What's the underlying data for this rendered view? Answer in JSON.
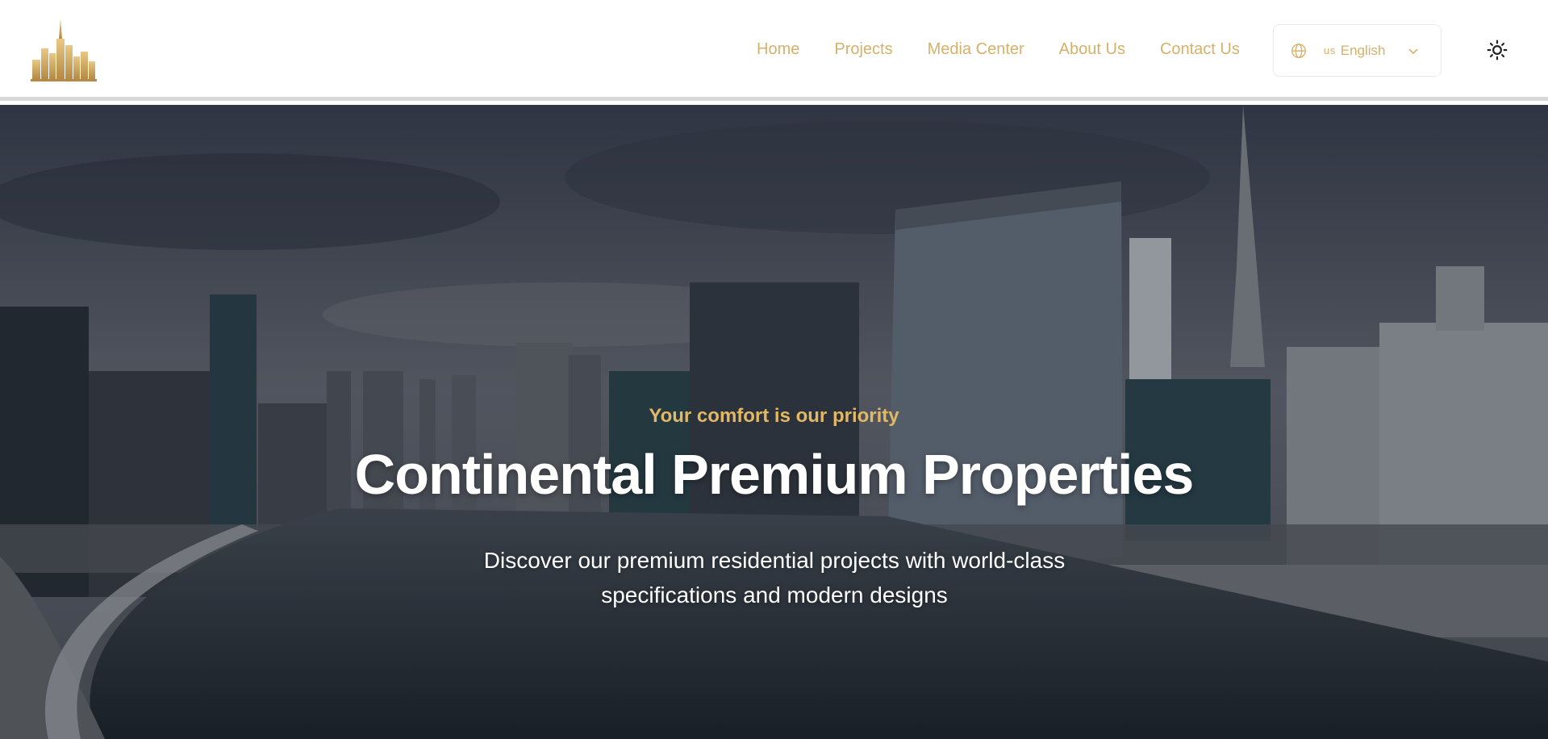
{
  "brand": {
    "logo_icon": "skyline-logo-icon",
    "accent_color": "#d6b16a"
  },
  "nav": {
    "items": [
      {
        "label": "Home"
      },
      {
        "label": "Projects"
      },
      {
        "label": "Media Center"
      },
      {
        "label": "About Us"
      },
      {
        "label": "Contact Us"
      }
    ]
  },
  "language": {
    "flag": "us",
    "label": "English",
    "icon": "globe-icon",
    "dropdown_icon": "chevron-down-icon"
  },
  "theme_toggle": {
    "icon": "sun-icon"
  },
  "hero": {
    "kicker": "Your comfort is our priority",
    "title": "Continental Premium Properties",
    "subtitle": "Discover our premium residential projects with world-class specifications and modern designs"
  }
}
